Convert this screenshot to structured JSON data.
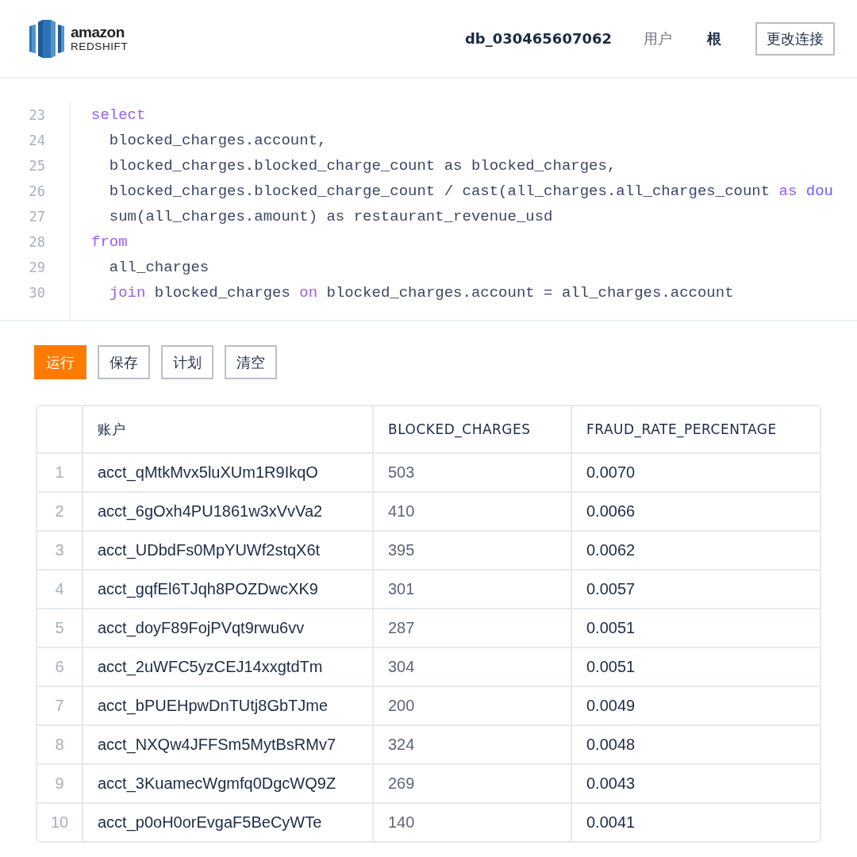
{
  "header": {
    "logo": {
      "brand": "amazon",
      "product": "REDSHIFT"
    },
    "database": "db_030465607062",
    "user_label": "用户",
    "user": "根",
    "change_connection": "更改连接"
  },
  "editor": {
    "lines": [
      {
        "number": "23",
        "tokens": [
          {
            "text": "select",
            "kind": "keyword"
          }
        ]
      },
      {
        "number": "24",
        "tokens": [
          {
            "text": "  blocked_charges.account,",
            "kind": "plain"
          }
        ]
      },
      {
        "number": "25",
        "tokens": [
          {
            "text": "  blocked_charges.blocked_charge_count as blocked_charges,",
            "kind": "plain"
          }
        ]
      },
      {
        "number": "26",
        "tokens": [
          {
            "text": "  blocked_charges.blocked_charge_count / cast(all_charges.all_charges_count ",
            "kind": "plain"
          },
          {
            "text": "as",
            "kind": "keyword"
          },
          {
            "text": " dou",
            "kind": "type"
          }
        ]
      },
      {
        "number": "27",
        "tokens": [
          {
            "text": "  sum(all_charges.amount) as restaurant_revenue_usd",
            "kind": "plain"
          }
        ]
      },
      {
        "number": "28",
        "tokens": [
          {
            "text": "from",
            "kind": "keyword"
          }
        ]
      },
      {
        "number": "29",
        "tokens": [
          {
            "text": "  all_charges",
            "kind": "plain"
          }
        ]
      },
      {
        "number": "30",
        "tokens": [
          {
            "text": "  join",
            "kind": "keyword"
          },
          {
            "text": " blocked_charges ",
            "kind": "plain"
          },
          {
            "text": "on",
            "kind": "keyword"
          },
          {
            "text": " blocked_charges.account = all_charges.account",
            "kind": "plain"
          }
        ]
      }
    ]
  },
  "actions": [
    {
      "label": "运行",
      "kind": "primary"
    },
    {
      "label": "保存",
      "kind": "secondary"
    },
    {
      "label": "计划",
      "kind": "secondary"
    },
    {
      "label": "清空",
      "kind": "secondary"
    }
  ],
  "table": {
    "columns": [
      "账户",
      "BLOCKED_CHARGES",
      "FRAUD_RATE_PERCENTAGE"
    ],
    "rows": [
      {
        "index": "1",
        "cells": [
          "acct_qMtkMvx5luXUm1R9IkqO",
          "503",
          "0.0070"
        ]
      },
      {
        "index": "2",
        "cells": [
          "acct_6gOxh4PU1861w3xVvVa2",
          "410",
          "0.0066"
        ]
      },
      {
        "index": "3",
        "cells": [
          "acct_UDbdFs0MpYUWf2stqX6t",
          "395",
          "0.0062"
        ]
      },
      {
        "index": "4",
        "cells": [
          "acct_gqfEl6TJqh8POZDwcXK9",
          "301",
          "0.0057"
        ]
      },
      {
        "index": "5",
        "cells": [
          "acct_doyF89FojPVqt9rwu6vv",
          "287",
          "0.0051"
        ]
      },
      {
        "index": "6",
        "cells": [
          "acct_2uWFC5yzCEJ14xxgtdTm",
          "304",
          "0.0051"
        ]
      },
      {
        "index": "7",
        "cells": [
          "acct_bPUEHpwDnTUtj8GbTJme",
          "200",
          "0.0049"
        ]
      },
      {
        "index": "8",
        "cells": [
          "acct_NXQw4JFFSm5MytBsRMv7",
          "324",
          "0.0048"
        ]
      },
      {
        "index": "9",
        "cells": [
          "acct_3KuamecWgmfq0DgcWQ9Z",
          "269",
          "0.0043"
        ]
      },
      {
        "index": "10",
        "cells": [
          "acct_p0oH0orEvgaF5BeCyWTe",
          "140",
          "0.0041"
        ]
      }
    ]
  }
}
